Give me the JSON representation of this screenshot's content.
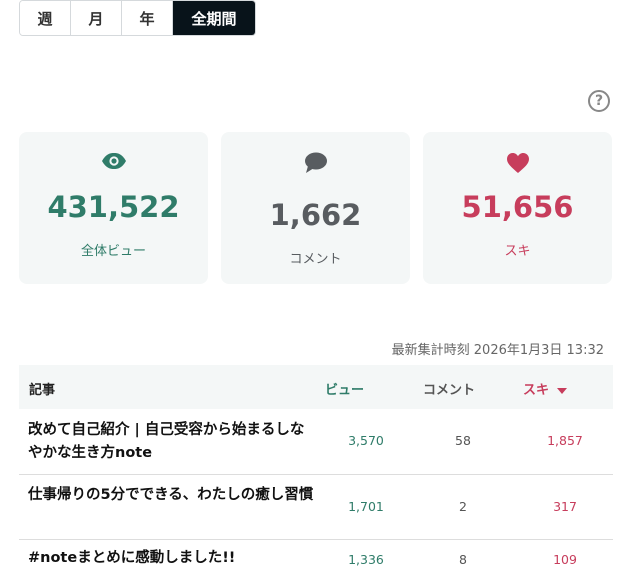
{
  "periods": [
    "週",
    "月",
    "年",
    "全期間"
  ],
  "active_period": "全期間",
  "help_icon": "?",
  "stats": {
    "views": {
      "value": "431,522",
      "label": "全体ビュー",
      "icon": "eye-icon",
      "color": "#2f7c69"
    },
    "comments": {
      "value": "1,662",
      "label": "コメント",
      "icon": "comment-icon",
      "color": "#585c60"
    },
    "likes": {
      "value": "51,656",
      "label": "スキ",
      "icon": "heart-icon",
      "color": "#c73d5c"
    }
  },
  "timestamp": "最新集計時刻 2026年1月3日 13:32",
  "table": {
    "headers": {
      "article": "記事",
      "views": "ビュー",
      "comments": "コメント",
      "likes": "スキ"
    },
    "rows": [
      {
        "title": "改めて自己紹介 | 自己受容から始まるしなやかな生き方note",
        "views": "3,570",
        "comments": "58",
        "likes": "1,857"
      },
      {
        "title": "仕事帰りの5分でできる、わたしの癒し習慣",
        "views": "1,701",
        "comments": "2",
        "likes": "317"
      },
      {
        "title": "#noteまとめに感動しました!!",
        "views": "1,336",
        "comments": "8",
        "likes": "109"
      }
    ]
  }
}
